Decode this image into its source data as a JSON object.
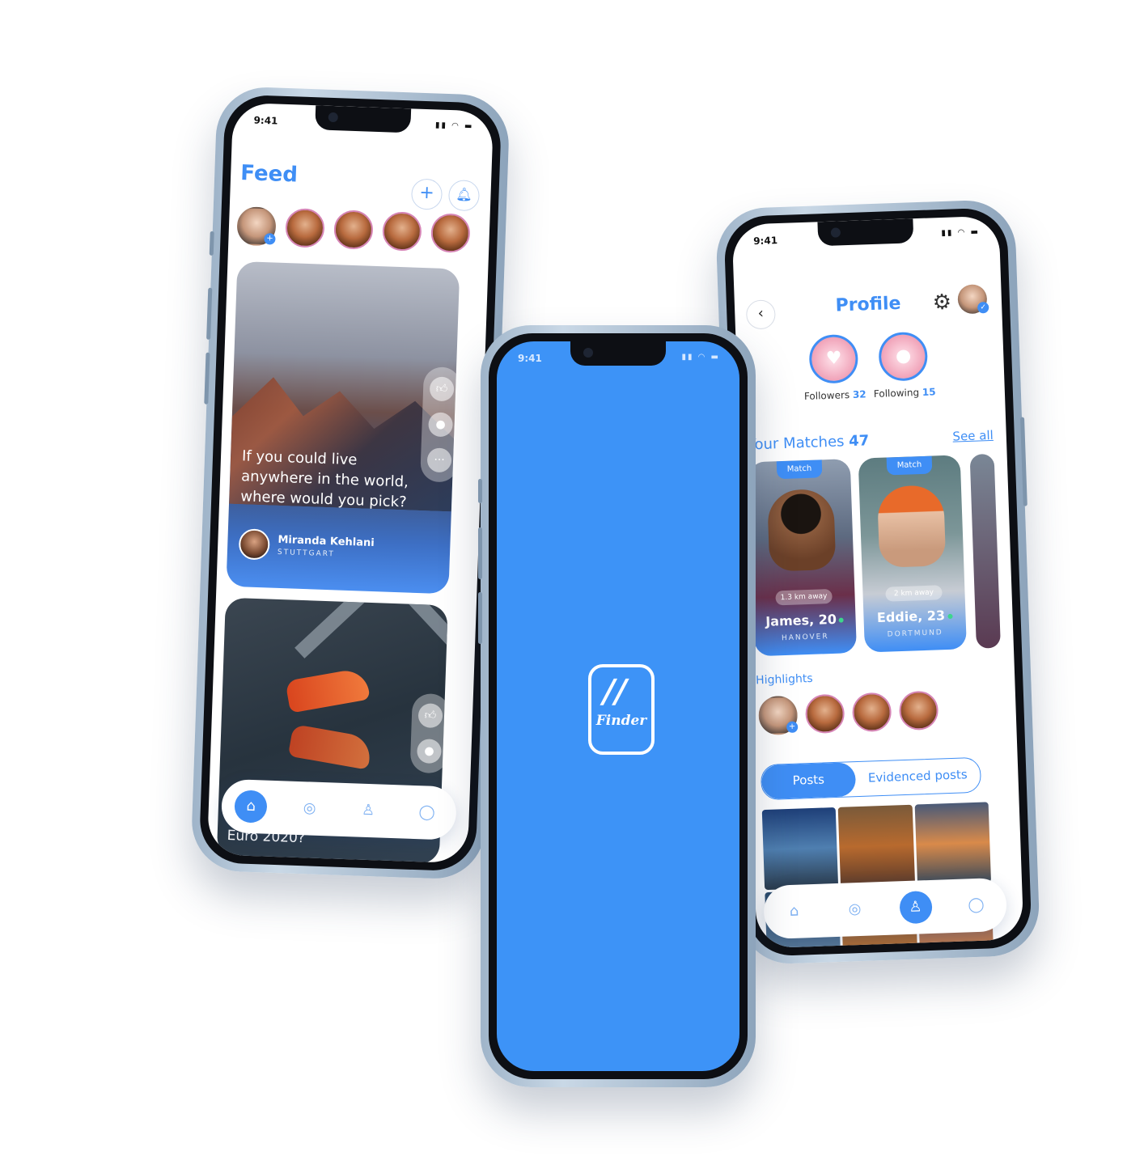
{
  "feed": {
    "status_time": "9:41",
    "title": "Feed",
    "post1": {
      "question": "If you could live anywhere in the world, where would you pick?",
      "author_name": "Miranda Kehlani",
      "author_city": "STUTTGART"
    },
    "post2": {
      "caption": "Euro 2020?"
    }
  },
  "splash": {
    "status_time": "9:41",
    "logo_mark": "//",
    "logo_text": "Finder"
  },
  "profile": {
    "status_time": "9:41",
    "title": "Profile",
    "followers_label": "Followers",
    "followers_count": "32",
    "following_label": "Following",
    "following_count": "15",
    "matches_label": "Your Matches",
    "matches_count": "47",
    "see_all": "See all",
    "matches": [
      {
        "badge": "Match",
        "distance": "1.3 km away",
        "name": "James, 20",
        "city": "HANOVER"
      },
      {
        "badge": "Match",
        "distance": "2 km away",
        "name": "Eddie, 23",
        "city": "DORTMUND"
      }
    ],
    "highlights_label": "Highlights",
    "tabs": {
      "posts": "Posts",
      "evidenced": "Evidenced posts"
    }
  },
  "colors": {
    "accent": "#3f8ef5",
    "splash_bg": "#3d93f7"
  },
  "icons": {
    "add": "plus-icon",
    "notifications": "bell-icon",
    "like": "thumbs-up-icon",
    "comment": "comment-icon",
    "more": "more-icon",
    "home": "home-icon",
    "explore": "compass-icon",
    "people": "people-icon",
    "chat": "chat-icon",
    "settings": "gear-icon",
    "back": "chevron-left-icon"
  }
}
